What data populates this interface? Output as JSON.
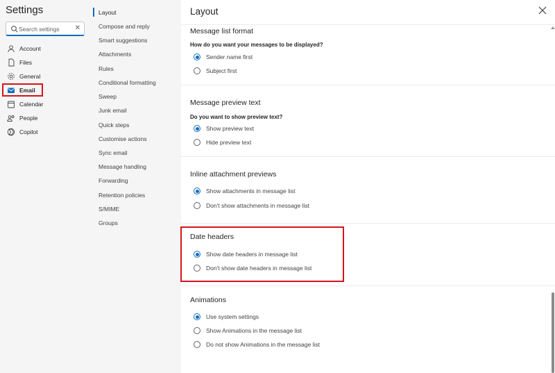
{
  "left_nav": {
    "title": "Settings",
    "search_placeholder": "Search settings",
    "items": [
      {
        "label": "Account",
        "icon": "person-icon"
      },
      {
        "label": "Files",
        "icon": "file-icon"
      },
      {
        "label": "General",
        "icon": "gear-icon"
      },
      {
        "label": "Email",
        "icon": "mail-icon"
      },
      {
        "label": "Calendar",
        "icon": "calendar-icon"
      },
      {
        "label": "People",
        "icon": "people-icon"
      },
      {
        "label": "Copilot",
        "icon": "copilot-icon"
      }
    ]
  },
  "email_subnav": {
    "items": [
      "Layout",
      "Compose and reply",
      "Smart suggestions",
      "Attachments",
      "Rules",
      "Conditional formatting",
      "Sweep",
      "Junk email",
      "Quick steps",
      "Customise actions",
      "Sync email",
      "Message handling",
      "Forwarding",
      "Retention policies",
      "S/MIME",
      "Groups"
    ],
    "selected": "Layout"
  },
  "content": {
    "title": "Layout",
    "sections": {
      "message_list_format": {
        "title": "Message list format",
        "question": "How do you want your messages to be displayed?",
        "options": [
          "Sender name first",
          "Subject first"
        ],
        "selected": "Sender name first"
      },
      "message_preview_text": {
        "title": "Message preview text",
        "question": "Do you want to show preview text?",
        "options": [
          "Show preview text",
          "Hide preview text"
        ],
        "selected": "Show preview text"
      },
      "inline_attachment_previews": {
        "title": "Inline attachment previews",
        "options": [
          "Show attachments in message list",
          "Don't show attachments in message list"
        ],
        "selected": "Show attachments in message list"
      },
      "date_headers": {
        "title": "Date headers",
        "options": [
          "Show date headers in message list",
          "Don't show date headers in message list"
        ],
        "selected": "Show date headers in message list"
      },
      "animations": {
        "title": "Animations",
        "options": [
          "Use system settings",
          "Show Animations in the message list",
          "Do not show Animations in the message list"
        ],
        "selected": "Use system settings"
      }
    }
  },
  "colors": {
    "accent": "#0f6cbd",
    "highlight": "#d4141b"
  }
}
